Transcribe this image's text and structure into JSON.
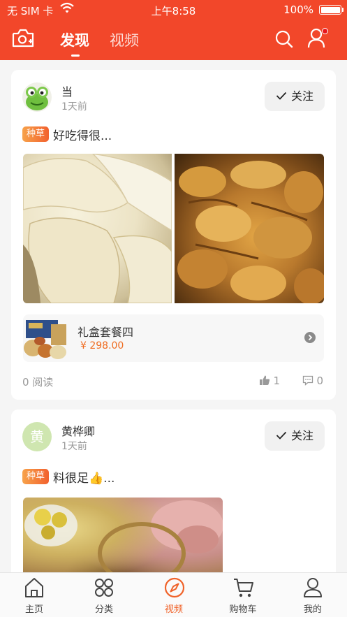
{
  "status_bar": {
    "carrier": "无 SIM 卡",
    "time": "上午8:58",
    "battery": "100%"
  },
  "header": {
    "tabs": [
      {
        "label": "发现",
        "active": true
      },
      {
        "label": "视频",
        "active": false
      }
    ],
    "accent_color": "#f2472a",
    "icons": [
      "camera-plus-icon",
      "search-icon",
      "user-icon"
    ]
  },
  "feed": [
    {
      "user": "当",
      "time": "1天前",
      "follow_label": "关注",
      "tag": "种草",
      "text": "好吃得很...",
      "product": {
        "name": "礼盒套餐四",
        "price": "¥ 298.00"
      },
      "reads": "0 阅读",
      "likes": "1",
      "comments": "0"
    },
    {
      "user": "黄桦卿",
      "avatar_letter": "黄",
      "time": "1天前",
      "follow_label": "关注",
      "tag": "种草",
      "text": "料很足👍..."
    }
  ],
  "tabbar": [
    {
      "label": "主页",
      "icon": "home-icon",
      "active": false
    },
    {
      "label": "分类",
      "icon": "category-icon",
      "active": false
    },
    {
      "label": "视频",
      "icon": "compass-icon",
      "active": true
    },
    {
      "label": "购物车",
      "icon": "cart-icon",
      "active": false
    },
    {
      "label": "我的",
      "icon": "profile-icon",
      "active": false
    }
  ]
}
